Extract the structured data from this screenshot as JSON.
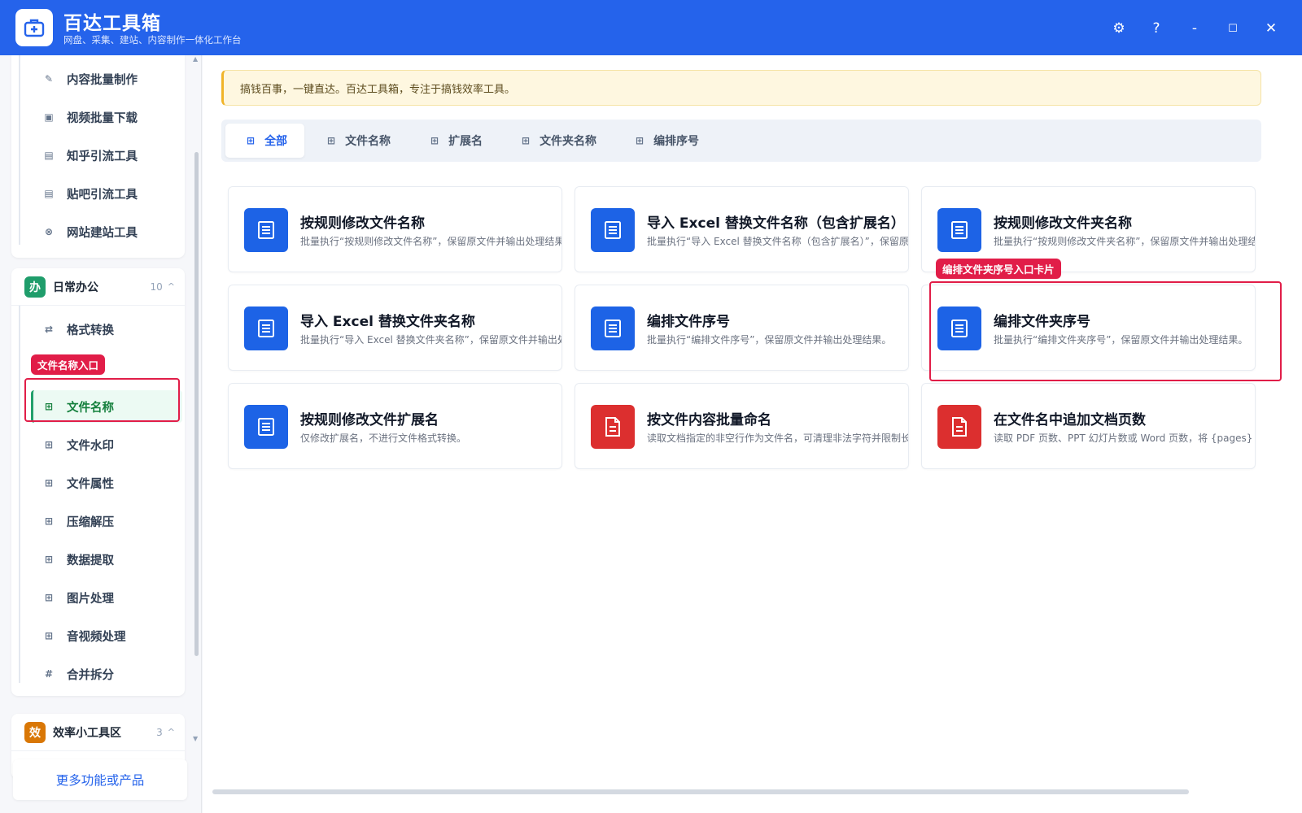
{
  "app": {
    "title": "百达工具箱",
    "subtitle": "网盘、采集、建站、内容制作一体化工作台",
    "controls": {
      "settings": "⚙",
      "help": "?",
      "minimize": "-",
      "maximize": "☐",
      "close": "✕"
    }
  },
  "sidebar": {
    "top_items": [
      {
        "label": "内容批量制作",
        "icon": "pencil-icon"
      },
      {
        "label": "视频批量下载",
        "icon": "video-icon"
      },
      {
        "label": "知乎引流工具",
        "icon": "zhihu-icon"
      },
      {
        "label": "贴吧引流工具",
        "icon": "tieba-icon"
      },
      {
        "label": "网站建站工具",
        "icon": "globe-icon"
      }
    ],
    "office_group": {
      "badge": "办",
      "name": "日常办公",
      "count": "10",
      "caret": "^",
      "items": [
        {
          "label": "格式转换",
          "icon": "swap-icon"
        },
        {
          "label": "文件名称",
          "icon": "grid-icon",
          "active": true
        },
        {
          "label": "文件水印",
          "icon": "grid-icon"
        },
        {
          "label": "文件属性",
          "icon": "grid-icon"
        },
        {
          "label": "压缩解压",
          "icon": "grid-icon"
        },
        {
          "label": "数据提取",
          "icon": "grid-icon"
        },
        {
          "label": "图片处理",
          "icon": "grid-icon"
        },
        {
          "label": "音视频处理",
          "icon": "grid-icon"
        },
        {
          "label": "合并拆分",
          "icon": "hash-icon"
        }
      ]
    },
    "eff_group": {
      "badge": "效",
      "name": "效率小工具区",
      "count": "3",
      "caret": "^"
    },
    "more_button": "更多功能或产品"
  },
  "annotations": {
    "file_name_entry": "文件名称入口",
    "folder_seq_card": "编排文件夹序号入口卡片"
  },
  "main": {
    "notice": "搞钱百事，一键直达。百达工具箱，专注于搞钱效率工具。",
    "tabs": [
      {
        "label": "全部",
        "active": true
      },
      {
        "label": "文件名称"
      },
      {
        "label": "扩展名"
      },
      {
        "label": "文件夹名称"
      },
      {
        "label": "编排序号"
      }
    ],
    "cards": [
      {
        "title": "按规则修改文件名称",
        "desc": "批量执行“按规则修改文件名称”，保留原文件并输出处理结果。",
        "color": "blue"
      },
      {
        "title": "导入 Excel 替换文件名称（包含扩展名）",
        "desc": "批量执行“导入 Excel 替换文件名称（包含扩展名）”，保留原文件",
        "color": "blue"
      },
      {
        "title": "按规则修改文件夹名称",
        "desc": "批量执行“按规则修改文件夹名称”，保留原文件并输出处理结果。",
        "color": "blue"
      },
      {
        "title": "导入 Excel 替换文件夹名称",
        "desc": "批量执行“导入 Excel 替换文件夹名称”，保留原文件并输出处理结",
        "color": "blue"
      },
      {
        "title": "编排文件序号",
        "desc": "批量执行“编排文件序号”，保留原文件并输出处理结果。",
        "color": "blue"
      },
      {
        "title": "编排文件夹序号",
        "desc": "批量执行“编排文件夹序号”，保留原文件并输出处理结果。",
        "color": "blue"
      },
      {
        "title": "按规则修改文件扩展名",
        "desc": "仅修改扩展名，不进行文件格式转换。",
        "color": "blue"
      },
      {
        "title": "按文件内容批量命名",
        "desc": "读取文档指定的非空行作为文件名，可清理非法字符并限制长度；",
        "color": "red"
      },
      {
        "title": "在文件名中追加文档页数",
        "desc": "读取 PDF 页数、PPT 幻灯片数或 Word 页数，将 {pages} 写入命名",
        "color": "red"
      }
    ]
  },
  "colors": {
    "primary": "#2563eb",
    "active_green": "#15803d",
    "highlight_red": "#e11d48",
    "card_blue": "#1d63e6",
    "card_red": "#dc2f2f"
  }
}
